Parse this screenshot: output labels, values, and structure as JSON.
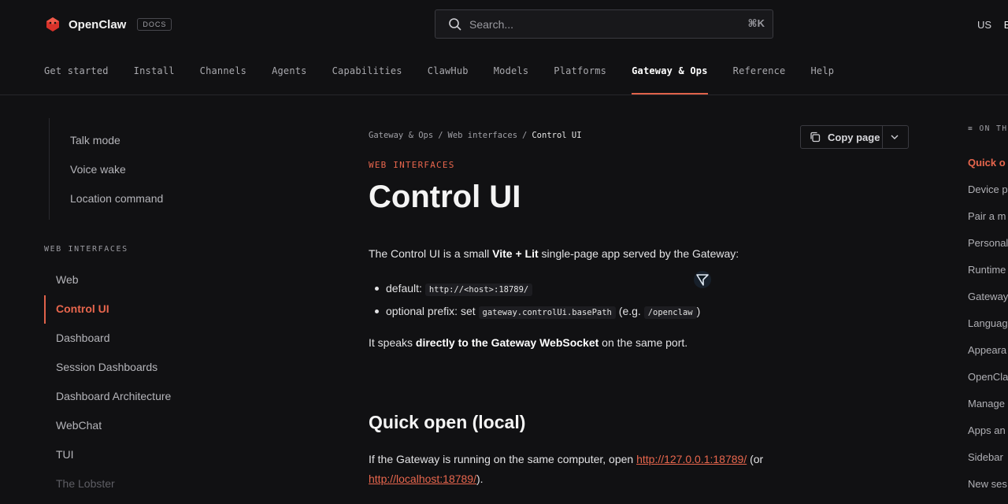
{
  "header": {
    "brand": "OpenClaw",
    "badge": "DOCS",
    "search_placeholder": "Search...",
    "search_shortcut": "⌘K",
    "locale_region": "US",
    "locale_lang": "En",
    "nav": [
      "Get started",
      "Install",
      "Channels",
      "Agents",
      "Capabilities",
      "ClawHub",
      "Models",
      "Platforms",
      "Gateway & Ops",
      "Reference",
      "Help"
    ],
    "active_nav": "Gateway & Ops"
  },
  "sidebar": {
    "sub_items": [
      "Talk mode",
      "Voice wake",
      "Location command"
    ],
    "section_label": "WEB INTERFACES",
    "items": [
      "Web",
      "Control UI",
      "Dashboard",
      "Session Dashboards",
      "Dashboard Architecture",
      "WebChat",
      "TUI",
      "The Lobster"
    ],
    "active_item": "Control UI"
  },
  "main": {
    "breadcrumb": [
      "Gateway & Ops",
      "Web interfaces",
      "Control UI"
    ],
    "breadcrumb_sep": "/",
    "copy_page": "Copy page",
    "eyebrow": "WEB INTERFACES",
    "title": "Control UI",
    "intro": {
      "pre": "The Control UI is a small ",
      "bold": "Vite + Lit",
      "post": " single-page app served by the Gateway:"
    },
    "bullets": [
      {
        "label": "default: ",
        "code": "http://<host>:18789/"
      },
      {
        "label": "optional prefix: set ",
        "code": "gateway.controlUi.basePath",
        "mid": " (e.g. ",
        "code2": "/openclaw",
        "post": ")"
      }
    ],
    "speaks": {
      "pre": "It speaks ",
      "bold": "directly to the Gateway WebSocket",
      "post": " on the same port."
    },
    "h2": "Quick open (local)",
    "quick": {
      "pre": "If the Gateway is running on the same computer, open ",
      "link1": "http://127.0.0.1:18789/",
      "mid": " (or ",
      "link2": "http://localhost:18789/",
      "post": ")."
    }
  },
  "toc": {
    "head": "ON TH",
    "items": [
      "Quick o",
      "Device p",
      "Pair a m",
      "Personal",
      "Runtime",
      "Gateway",
      "Languag",
      "Appeara",
      "OpenCla",
      "Manage",
      "Apps an",
      "Sidebar",
      "New ses"
    ],
    "active": "Quick o"
  },
  "colors": {
    "accent": "#e0624a",
    "background": "#111113"
  }
}
